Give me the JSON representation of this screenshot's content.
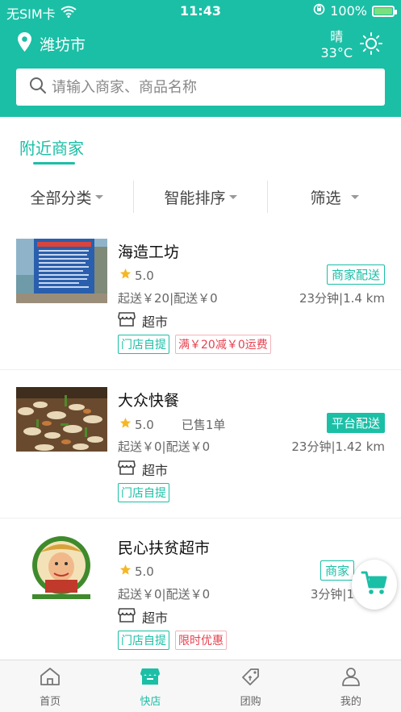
{
  "status": {
    "carrier": "无SIM卡",
    "time": "11:43",
    "battery": "100%"
  },
  "header": {
    "city": "潍坊市",
    "weather_desc": "晴",
    "temperature": "33°C",
    "search_placeholder": "请输入商家、商品名称"
  },
  "section_title": "附近商家",
  "filters": [
    {
      "label": "全部分类"
    },
    {
      "label": "智能排序"
    },
    {
      "label": "筛选"
    }
  ],
  "shops": [
    {
      "name": "海造工坊",
      "rating": "5.0",
      "sold": "",
      "fees": "起送￥20|配送￥0",
      "distance": "23分钟|1.4 km",
      "delivery": "商家配送",
      "category": "超市",
      "tags": [
        {
          "text": "门店自提",
          "style": "green"
        },
        {
          "text": "满￥20减￥0运费",
          "style": "red"
        }
      ]
    },
    {
      "name": "大众快餐",
      "rating": "5.0",
      "sold": "已售1单",
      "fees": "起送￥0|配送￥0",
      "distance": "23分钟|1.42 km",
      "delivery": "平台配送",
      "category": "超市",
      "tags": [
        {
          "text": "门店自提",
          "style": "green"
        }
      ]
    },
    {
      "name": "民心扶贫超市",
      "rating": "5.0",
      "sold": "",
      "fees": "起送￥0|配送￥0",
      "distance": "3分钟|1",
      "delivery": "商家",
      "category": "超市",
      "tags": [
        {
          "text": "门店自提",
          "style": "green"
        },
        {
          "text": "限时优惠",
          "style": "red"
        }
      ]
    }
  ],
  "tabs": [
    {
      "label": "首页",
      "icon": "home-icon"
    },
    {
      "label": "快店",
      "icon": "store-icon"
    },
    {
      "label": "团购",
      "icon": "coupon-icon"
    },
    {
      "label": "我的",
      "icon": "user-icon"
    }
  ],
  "colors": {
    "accent": "#1bbfa6",
    "promo_red": "#e7414f",
    "star": "#f5b723"
  }
}
